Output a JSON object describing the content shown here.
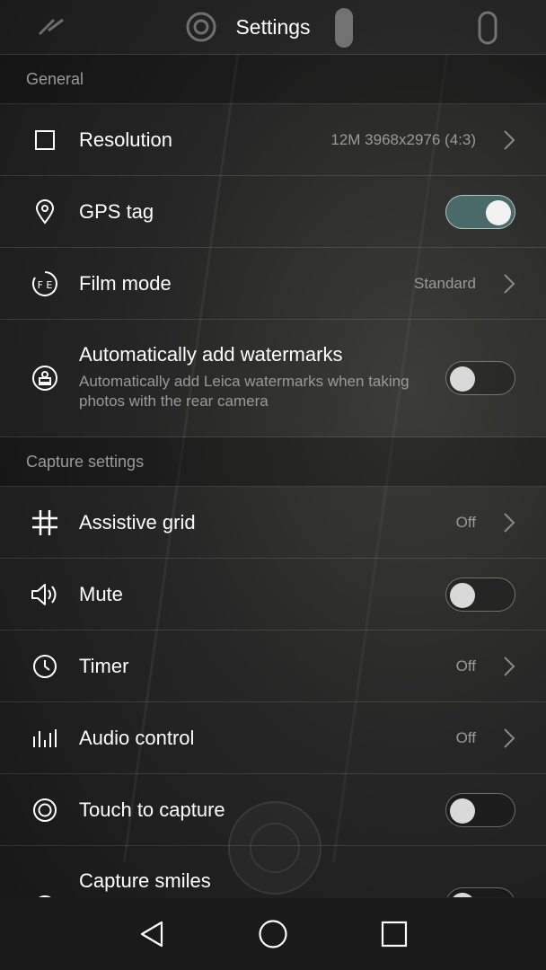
{
  "header": {
    "title": "Settings"
  },
  "sections": {
    "general": "General",
    "capture": "Capture settings"
  },
  "rows": {
    "resolution": {
      "label": "Resolution",
      "value": "12M 3968x2976 (4:3)",
      "icon": "square-icon"
    },
    "gps": {
      "label": "GPS tag",
      "toggle": true,
      "icon": "location-pin-icon"
    },
    "film": {
      "label": "Film mode",
      "value": "Standard",
      "icon": "film-fe-icon"
    },
    "watermark": {
      "label": "Automatically add watermarks",
      "sub": "Automatically add Leica watermarks when taking photos with the rear camera",
      "toggle": false,
      "icon": "stamp-icon"
    },
    "grid": {
      "label": "Assistive grid",
      "value": "Off",
      "icon": "grid-icon"
    },
    "mute": {
      "label": "Mute",
      "toggle": false,
      "icon": "speaker-icon"
    },
    "timer": {
      "label": "Timer",
      "value": "Off",
      "icon": "clock-icon"
    },
    "audio": {
      "label": "Audio control",
      "value": "Off",
      "icon": "audio-bars-icon"
    },
    "touch": {
      "label": "Touch to capture",
      "toggle": false,
      "icon": "target-icon"
    },
    "smiles": {
      "label": "Capture smiles",
      "toggle": false,
      "icon": "smile-icon"
    }
  },
  "navigation": [
    "back-icon",
    "home-icon",
    "recents-icon"
  ],
  "colors": {
    "accent_on": "#4a6a6a",
    "secondary_text": "#9a9a9a"
  }
}
